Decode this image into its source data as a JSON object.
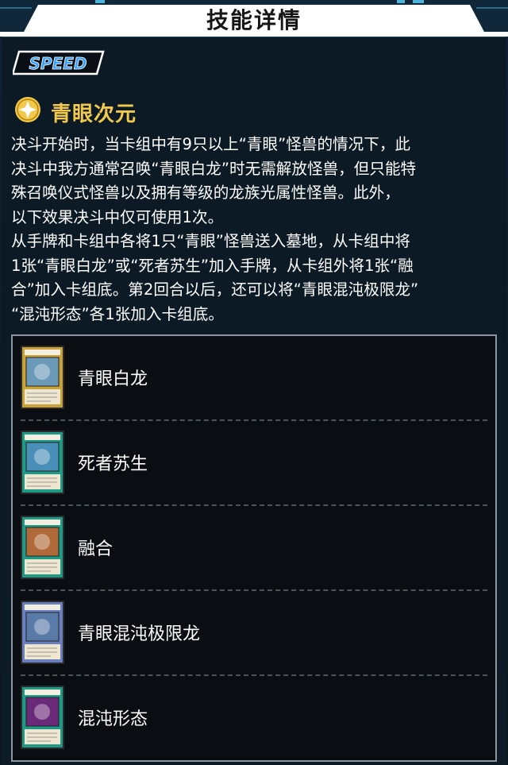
{
  "header": {
    "title": "技能详情"
  },
  "badge": {
    "label": "SPEED"
  },
  "skill": {
    "icon": "star-coin-icon",
    "name": "青眼次元",
    "description_lines": [
      "决斗开始时，当卡组中有9只以上“青眼”怪兽的情况下，此",
      "决斗中我方通常召唤“青眼白龙”时无需解放怪兽，但只能特",
      "殊召唤仪式怪兽以及拥有等级的龙族光属性怪兽。此外，",
      "以下效果决斗中仅可使用1次。",
      "从手牌和卡组中各将1只“青眼”怪兽送入墓地，从卡组中将",
      "1张“青眼白龙”或“死者苏生”加入手牌，从卡组外将1张“融",
      "合”加入卡组底。第2回合以后，还可以将“青眼混沌极限龙”",
      "“混沌形态”各1张加入卡组底。"
    ]
  },
  "cards": [
    {
      "name": "青眼白龙",
      "type": "monster",
      "icon": "blue-eyes-white-dragon-card-icon"
    },
    {
      "name": "死者苏生",
      "type": "spell",
      "icon": "monster-reborn-card-icon"
    },
    {
      "name": "融合",
      "type": "spell",
      "icon": "polymerization-card-icon"
    },
    {
      "name": "青眼混沌极限龙",
      "type": "ritual",
      "icon": "blue-eyes-chaos-max-dragon-card-icon"
    },
    {
      "name": "混沌形态",
      "type": "spell",
      "icon": "chaos-form-card-icon"
    }
  ],
  "colors": {
    "accent_gold": "#f2c94c",
    "panel_bg": "#0c1a26",
    "list_border": "#8a96a0",
    "speed_blue": "#1e90ff"
  }
}
